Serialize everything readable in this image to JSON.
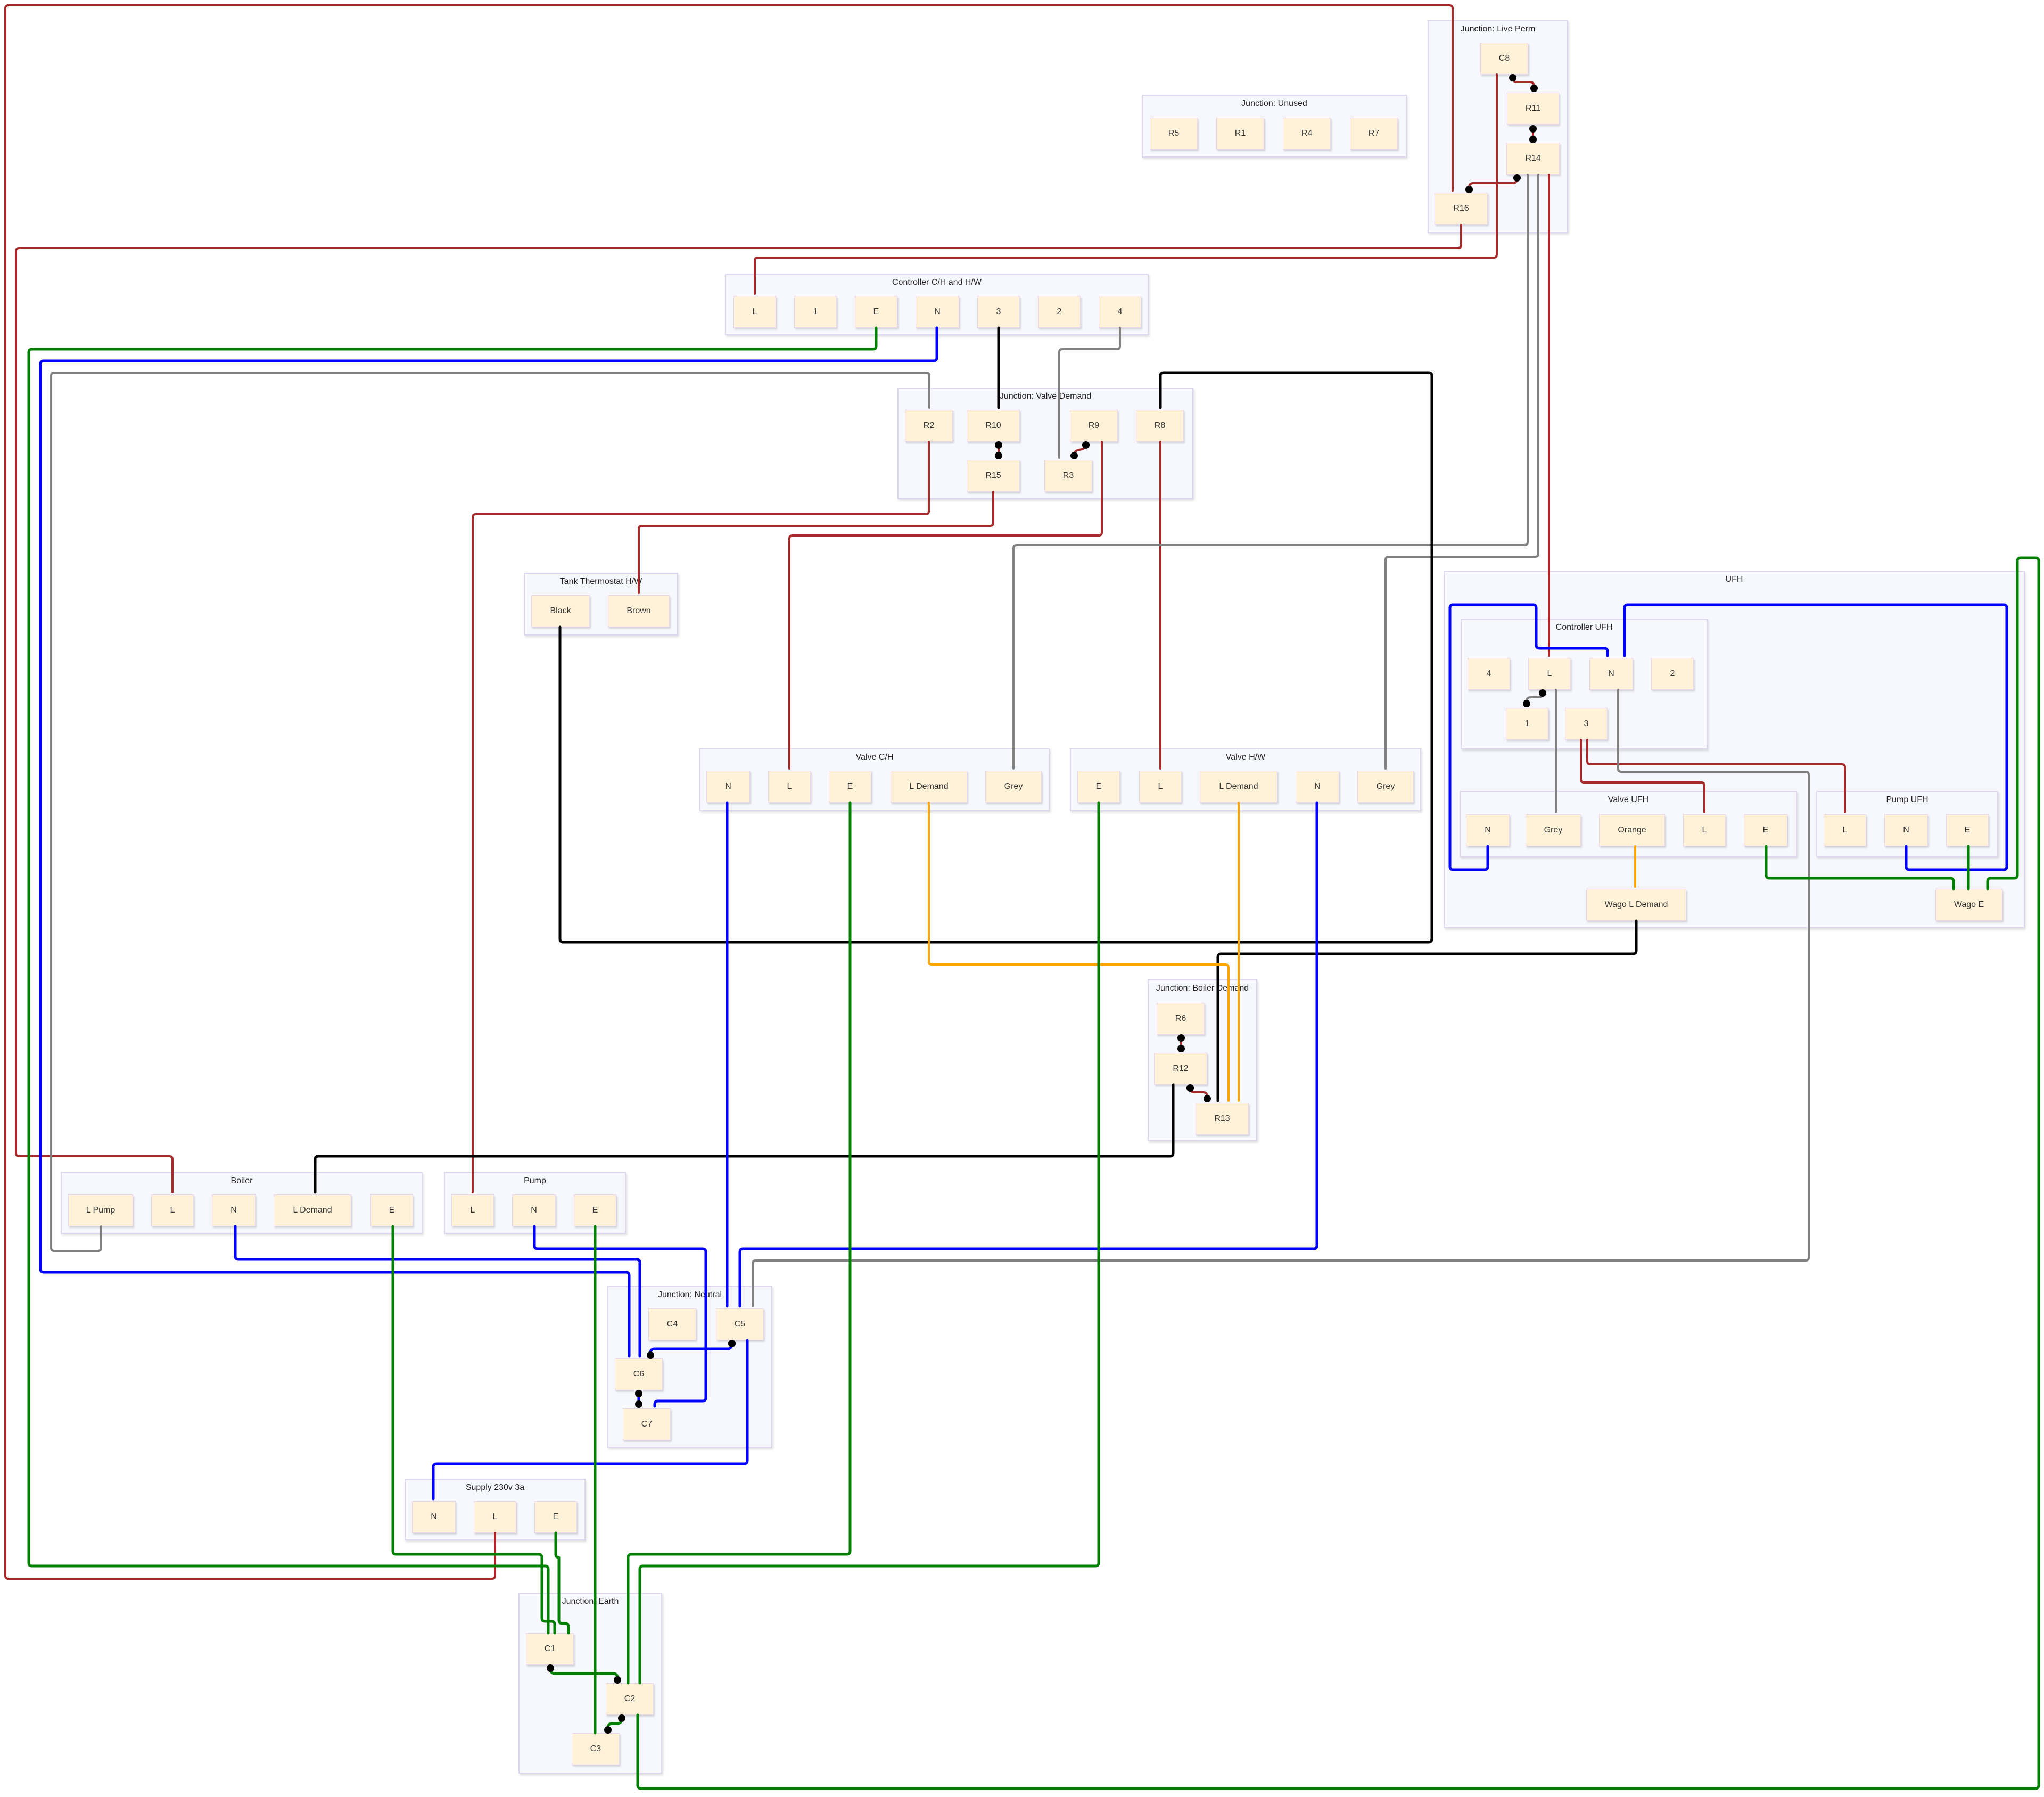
{
  "colors": {
    "live": "#a52a2a",
    "neutral": "#0000ff",
    "earth": "#008000",
    "switched": "#000000",
    "grey": "#808080",
    "demand": "#ffa500"
  },
  "groups": [
    {
      "id": "live_perm",
      "title": "Junction: Live Perm",
      "nodes": [
        "C8",
        "R11",
        "R14",
        "R16"
      ]
    },
    {
      "id": "unused",
      "title": "Junction: Unused",
      "nodes": [
        "R5",
        "R1",
        "R4",
        "R7"
      ]
    },
    {
      "id": "ctrl_chw",
      "title": "Controller C/H and H/W",
      "nodes": [
        "L",
        "1",
        "E",
        "N",
        "3",
        "2",
        "4"
      ]
    },
    {
      "id": "valve_demand",
      "title": "Junction: Valve Demand",
      "nodes": [
        "R2",
        "R10",
        "R9",
        "R8",
        "R15",
        "R3"
      ]
    },
    {
      "id": "tank",
      "title": "Tank Thermostat H/W",
      "nodes": [
        "Black",
        "Brown"
      ]
    },
    {
      "id": "valve_ch",
      "title": "Valve C/H",
      "nodes": [
        "N",
        "L",
        "E",
        "L Demand",
        "Grey"
      ]
    },
    {
      "id": "valve_hw",
      "title": "Valve H/W",
      "nodes": [
        "E",
        "L",
        "L Demand",
        "N",
        "Grey"
      ]
    },
    {
      "id": "ufh",
      "title": "UFH",
      "nodes": [
        "Wago L Demand",
        "Wago E"
      ]
    },
    {
      "id": "ctrl_ufh",
      "title": "Controller UFH",
      "nodes": [
        "4",
        "L",
        "N",
        "2",
        "1",
        "3"
      ]
    },
    {
      "id": "valve_ufh",
      "title": "Valve UFH",
      "nodes": [
        "N",
        "Grey",
        "Orange",
        "L",
        "E"
      ]
    },
    {
      "id": "pump_ufh",
      "title": "Pump UFH",
      "nodes": [
        "L",
        "N",
        "E"
      ]
    },
    {
      "id": "boiler_demand",
      "title": "Junction: Boiler Demand",
      "nodes": [
        "R6",
        "R12",
        "R13"
      ]
    },
    {
      "id": "boiler",
      "title": "Boiler",
      "nodes": [
        "L Pump",
        "L",
        "N",
        "L Demand",
        "E"
      ]
    },
    {
      "id": "pump",
      "title": "Pump",
      "nodes": [
        "L",
        "N",
        "E"
      ]
    },
    {
      "id": "neutral",
      "title": "Junction: Neutral",
      "nodes": [
        "C4",
        "C5",
        "C6",
        "C7"
      ]
    },
    {
      "id": "supply",
      "title": "Supply 230v 3a",
      "nodes": [
        "N",
        "L",
        "E"
      ]
    },
    {
      "id": "earth",
      "title": "Junction: Earth",
      "nodes": [
        "C1",
        "C2",
        "C3"
      ]
    }
  ],
  "connections": [
    {
      "from": "Junction: Live Perm.C8",
      "to": "Junction: Live Perm.R11",
      "color": "live",
      "type": "bridge"
    },
    {
      "from": "Junction: Live Perm.R11",
      "to": "Junction: Live Perm.R14",
      "color": "live",
      "type": "bridge"
    },
    {
      "from": "Junction: Live Perm.R14",
      "to": "Junction: Live Perm.R16",
      "color": "live",
      "type": "bridge"
    },
    {
      "from": "Supply 230v 3a.L",
      "to": "Junction: Live Perm.R16",
      "color": "live",
      "type": "arrow"
    },
    {
      "from": "Junction: Live Perm.R16",
      "to": "Boiler.L",
      "color": "live",
      "type": "arrow"
    },
    {
      "from": "Junction: Live Perm.C8",
      "to": "Controller C/H and H/W.L",
      "color": "live",
      "type": "arrow"
    },
    {
      "from": "Junction: Live Perm.R14",
      "to": "Controller UFH.L",
      "color": "live",
      "type": "arrow"
    },
    {
      "from": "Junction: Live Perm.R14",
      "to": "Valve C/H.Grey",
      "color": "grey",
      "type": "arrow"
    },
    {
      "from": "Junction: Live Perm.R14",
      "to": "Valve H/W.Grey",
      "color": "grey",
      "type": "arrow"
    },
    {
      "from": "Controller C/H and H/W.3",
      "to": "Junction: Valve Demand.R10",
      "color": "switched",
      "type": "arrow"
    },
    {
      "from": "Controller C/H and H/W.4",
      "to": "Junction: Valve Demand.R3",
      "color": "grey",
      "type": "arrow"
    },
    {
      "from": "Controller C/H and H/W.E",
      "to": "Junction: Earth.C1",
      "color": "earth",
      "type": "line"
    },
    {
      "from": "Controller C/H and H/W.N",
      "to": "Junction: Neutral.C6",
      "color": "neutral",
      "type": "arrow"
    },
    {
      "from": "Boiler.L Pump",
      "to": "Junction: Valve Demand.R2",
      "color": "grey",
      "type": "arrow"
    },
    {
      "from": "Junction: Valve Demand.R10",
      "to": "Junction: Valve Demand.R15",
      "color": "live",
      "type": "bridge"
    },
    {
      "from": "Junction: Valve Demand.R9",
      "to": "Junction: Valve Demand.R3",
      "color": "live",
      "type": "bridge"
    },
    {
      "from": "Junction: Valve Demand.R2",
      "to": "Pump.L",
      "color": "live",
      "type": "arrow"
    },
    {
      "from": "Junction: Valve Demand.R15",
      "to": "Tank Thermostat H/W.Brown",
      "color": "live",
      "type": "arrow"
    },
    {
      "from": "Junction: Valve Demand.R9",
      "to": "Valve C/H.L",
      "color": "live",
      "type": "arrow"
    },
    {
      "from": "Junction: Valve Demand.R8",
      "to": "Valve H/W.L",
      "color": "live",
      "type": "arrow"
    },
    {
      "from": "Tank Thermostat H/W.Black",
      "to": "Junction: Valve Demand.R8",
      "color": "switched",
      "type": "arrow"
    },
    {
      "from": "Valve C/H.N",
      "to": "Junction: Neutral.C5",
      "color": "neutral",
      "type": "arrow"
    },
    {
      "from": "Valve C/H.E",
      "to": "Junction: Earth.C2",
      "color": "earth",
      "type": "line"
    },
    {
      "from": "Valve C/H.L Demand",
      "to": "Junction: Boiler Demand.R13",
      "color": "demand",
      "type": "arrow"
    },
    {
      "from": "Valve H/W.E",
      "to": "Junction: Earth.C2",
      "color": "earth",
      "type": "line"
    },
    {
      "from": "Valve H/W.L Demand",
      "to": "Junction: Boiler Demand.R13",
      "color": "demand",
      "type": "arrow"
    },
    {
      "from": "Valve H/W.N",
      "to": "Junction: Neutral.C5",
      "color": "neutral",
      "type": "arrow"
    },
    {
      "from": "Controller UFH.L",
      "to": "Controller UFH.1",
      "color": "grey",
      "type": "bridge"
    },
    {
      "from": "Controller UFH.L",
      "to": "Valve UFH.Grey",
      "color": "grey",
      "type": "arrow"
    },
    {
      "from": "Controller UFH.N",
      "to": "Junction: Neutral.C5",
      "color": "grey",
      "type": "arrow"
    },
    {
      "from": "Controller UFH.3",
      "to": "Valve UFH.L",
      "color": "live",
      "type": "arrow"
    },
    {
      "from": "Controller UFH.3",
      "to": "Pump UFH.L",
      "color": "live",
      "type": "arrow"
    },
    {
      "from": "Valve UFH.N",
      "to": "Controller UFH.N",
      "color": "neutral",
      "type": "arrow"
    },
    {
      "from": "Pump UFH.N",
      "to": "Controller UFH.N",
      "color": "neutral",
      "type": "arrow"
    },
    {
      "from": "Valve UFH.Orange",
      "to": "UFH.Wago L Demand",
      "color": "demand",
      "type": "arrow"
    },
    {
      "from": "Valve UFH.E",
      "to": "UFH.Wago E",
      "color": "earth",
      "type": "line"
    },
    {
      "from": "Pump UFH.E",
      "to": "UFH.Wago E",
      "color": "earth",
      "type": "line"
    },
    {
      "from": "UFH.Wago E",
      "to": "Junction: Earth.C2",
      "color": "earth",
      "type": "line"
    },
    {
      "from": "UFH.Wago L Demand",
      "to": "Junction: Boiler Demand.R13",
      "color": "switched",
      "type": "arrow"
    },
    {
      "from": "Junction: Boiler Demand.R6",
      "to": "Junction: Boiler Demand.R12",
      "color": "live",
      "type": "bridge"
    },
    {
      "from": "Junction: Boiler Demand.R12",
      "to": "Junction: Boiler Demand.R13",
      "color": "live",
      "type": "bridge"
    },
    {
      "from": "Junction: Boiler Demand.R12",
      "to": "Boiler.L Demand",
      "color": "switched",
      "type": "arrow"
    },
    {
      "from": "Boiler.N",
      "to": "Junction: Neutral.C6",
      "color": "neutral",
      "type": "arrow"
    },
    {
      "from": "Boiler.E",
      "to": "Junction: Earth.C1",
      "color": "earth",
      "type": "line"
    },
    {
      "from": "Pump.N",
      "to": "Junction: Neutral.C7",
      "color": "neutral",
      "type": "arrow"
    },
    {
      "from": "Pump.E",
      "to": "Junction: Earth.C3",
      "color": "earth",
      "type": "line"
    },
    {
      "from": "Junction: Neutral.C5",
      "to": "Junction: Neutral.C6",
      "color": "neutral",
      "type": "bridge"
    },
    {
      "from": "Junction: Neutral.C6",
      "to": "Junction: Neutral.C7",
      "color": "neutral",
      "type": "bridge"
    },
    {
      "from": "Junction: Neutral.C5",
      "to": "Supply 230v 3a.N",
      "color": "neutral",
      "type": "arrow"
    },
    {
      "from": "Supply 230v 3a.E",
      "to": "Junction: Earth.C1",
      "color": "earth",
      "type": "line"
    },
    {
      "from": "Junction: Earth.C1",
      "to": "Junction: Earth.C2",
      "color": "earth",
      "type": "bridge"
    },
    {
      "from": "Junction: Earth.C2",
      "to": "Junction: Earth.C3",
      "color": "earth",
      "type": "bridge"
    }
  ]
}
